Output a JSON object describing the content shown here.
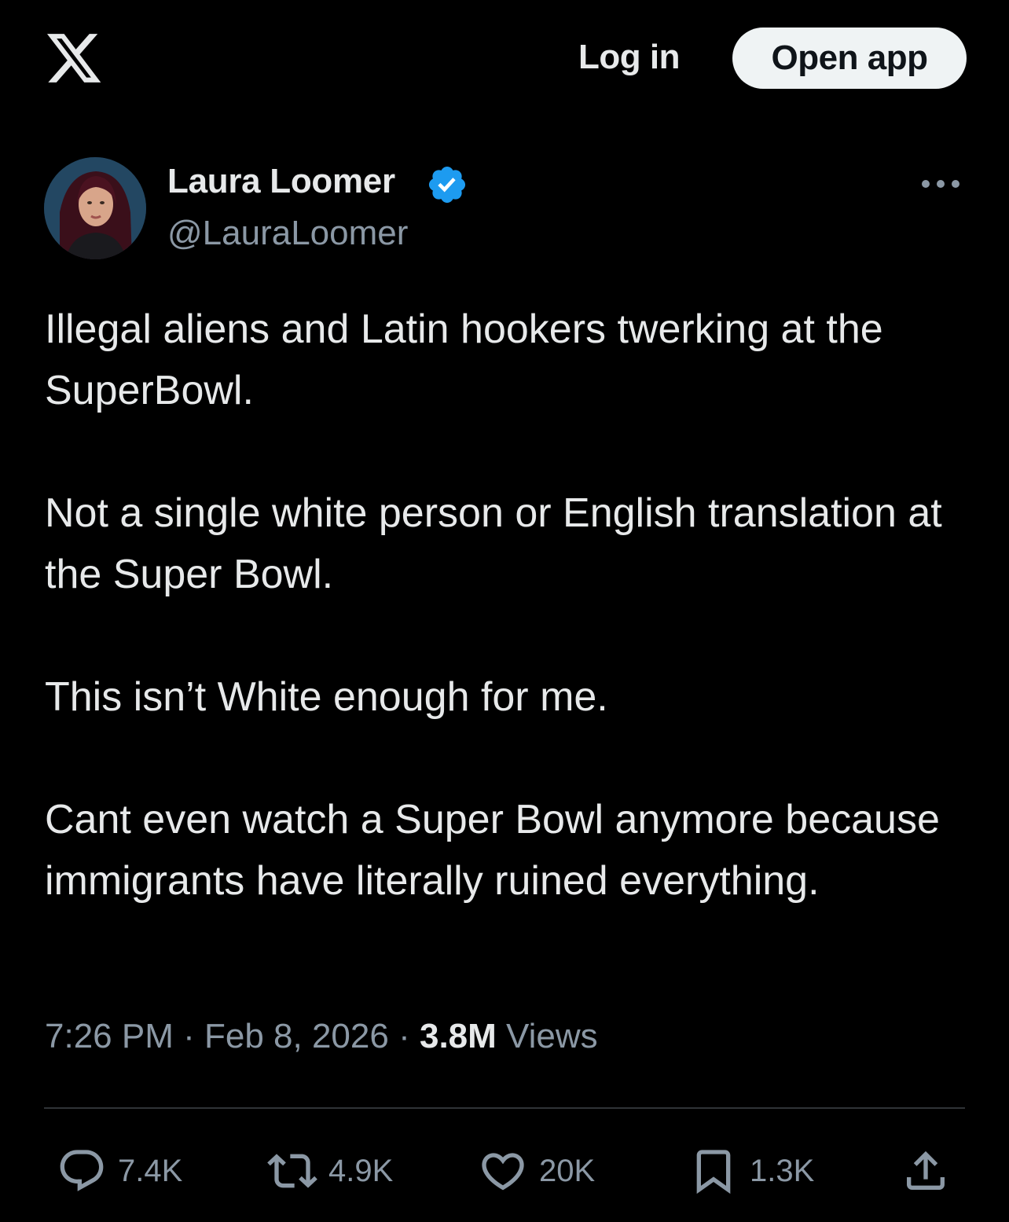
{
  "header": {
    "login_label": "Log in",
    "open_app_label": "Open app"
  },
  "author": {
    "display_name": "Laura Loomer",
    "handle": "@LauraLoomer"
  },
  "tweet": {
    "paragraphs": [
      "Illegal aliens and Latin hookers twerking at the SuperBowl.",
      "Not a single white person or English translation at the Super Bowl.",
      "This isn’t White enough for me.",
      "Cant even watch a Super Bowl anymore because immigrants have literally ruined everything."
    ],
    "time": "7:26 PM",
    "date": "Feb 8, 2026",
    "views_count": "3.8M",
    "views_label": "Views"
  },
  "actions": {
    "replies": "7.4K",
    "reposts": "4.9K",
    "likes": "20K",
    "bookmarks": "1.3K"
  },
  "icons": {
    "logo": "x-logo-icon",
    "verified": "verified-badge-icon",
    "more": "more-icon",
    "reply": "reply-icon",
    "repost": "repost-icon",
    "like": "heart-icon",
    "bookmark": "bookmark-icon",
    "share": "share-icon"
  },
  "colors": {
    "background": "#000000",
    "text_primary": "#e7e9ea",
    "text_secondary": "#8b98a5",
    "verified_blue": "#1d9bf0",
    "button_bg": "#eff3f4",
    "divider": "#2f3336"
  }
}
